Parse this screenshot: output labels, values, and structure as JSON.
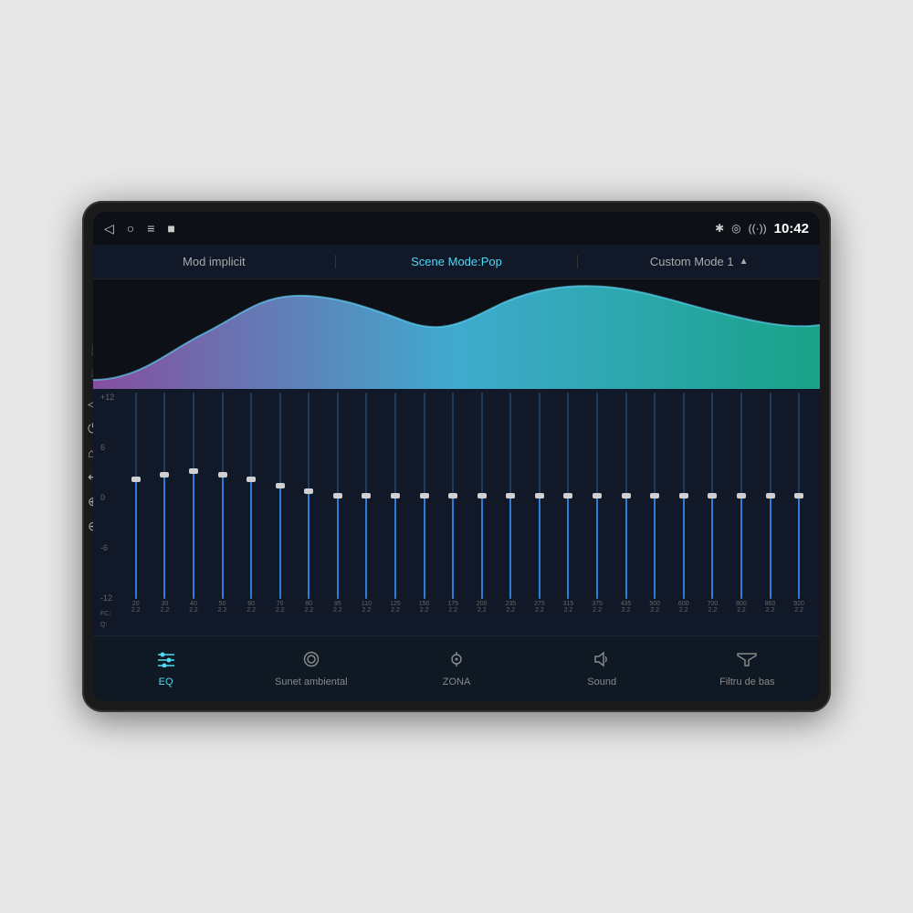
{
  "device": {
    "mic_label": "MIC",
    "rst_label": "RST"
  },
  "status_bar": {
    "time": "10:42",
    "nav_icons": [
      "◁",
      "○",
      "≡",
      "■"
    ]
  },
  "mode_bar": {
    "items": [
      {
        "id": "mod-implicit",
        "label": "Mod implicit",
        "active": false
      },
      {
        "id": "scene-mode",
        "label": "Scene Mode:Pop",
        "active": true
      },
      {
        "id": "custom-mode",
        "label": "Custom Mode 1",
        "active": false,
        "has_arrow": true
      }
    ]
  },
  "eq_sliders": {
    "db_labels": [
      "+12",
      "6",
      "0",
      "-6",
      "-12"
    ],
    "bands": [
      {
        "fc": "20",
        "q": "2.2",
        "level": 0.5
      },
      {
        "fc": "30",
        "q": "2.2",
        "level": 0.5
      },
      {
        "fc": "40",
        "q": "2.2",
        "level": 0.5
      },
      {
        "fc": "50",
        "q": "2.2",
        "level": 0.5
      },
      {
        "fc": "60",
        "q": "2.2",
        "level": 0.5
      },
      {
        "fc": "70",
        "q": "2.2",
        "level": 0.5
      },
      {
        "fc": "80",
        "q": "2.2",
        "level": 0.5
      },
      {
        "fc": "95",
        "q": "2.2",
        "level": 0.5
      },
      {
        "fc": "110",
        "q": "2.2",
        "level": 0.5
      },
      {
        "fc": "125",
        "q": "2.2",
        "level": 0.5
      },
      {
        "fc": "150",
        "q": "2.2",
        "level": 0.5
      },
      {
        "fc": "175",
        "q": "2.2",
        "level": 0.5
      },
      {
        "fc": "200",
        "q": "2.2",
        "level": 0.5
      },
      {
        "fc": "235",
        "q": "2.2",
        "level": 0.5
      },
      {
        "fc": "275",
        "q": "2.2",
        "level": 0.5
      },
      {
        "fc": "315",
        "q": "2.2",
        "level": 0.5
      },
      {
        "fc": "375",
        "q": "2.2",
        "level": 0.5
      },
      {
        "fc": "435",
        "q": "2.2",
        "level": 0.5
      },
      {
        "fc": "500",
        "q": "2.2",
        "level": 0.5
      },
      {
        "fc": "600",
        "q": "2.2",
        "level": 0.5
      },
      {
        "fc": "700",
        "q": "2.2",
        "level": 0.5
      },
      {
        "fc": "800",
        "q": "2.2",
        "level": 0.5
      },
      {
        "fc": "860",
        "q": "2.2",
        "level": 0.5
      },
      {
        "fc": "920",
        "q": "2.2",
        "level": 0.5
      }
    ],
    "fc_label": "FC:",
    "q_label": "Q:"
  },
  "bottom_nav": {
    "tabs": [
      {
        "id": "eq",
        "label": "EQ",
        "active": true
      },
      {
        "id": "sunet-ambiental",
        "label": "Sunet ambiental",
        "active": false
      },
      {
        "id": "zona",
        "label": "ZONA",
        "active": false
      },
      {
        "id": "sound",
        "label": "Sound",
        "active": false
      },
      {
        "id": "filtru-de-bas",
        "label": "Filtru de bas",
        "active": false
      }
    ]
  },
  "colors": {
    "active": "#4dd9f5",
    "inactive": "#888888",
    "slider_fill": "#2a7fd4",
    "slider_track": "#1e3a5f"
  }
}
